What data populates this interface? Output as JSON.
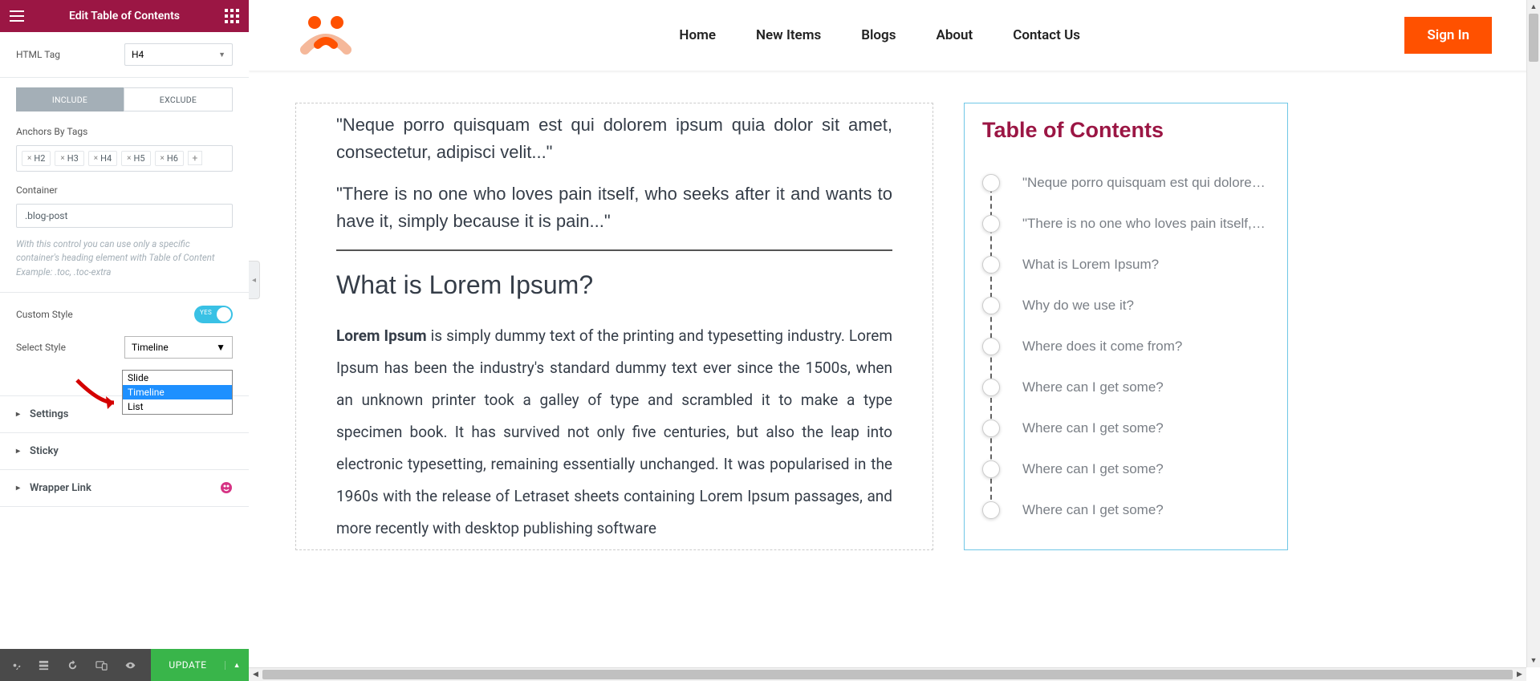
{
  "panel": {
    "title": "Edit Table of Contents",
    "htmlTagLabel": "HTML Tag",
    "htmlTagValue": "H4",
    "includeLabel": "INCLUDE",
    "excludeLabel": "EXCLUDE",
    "anchorsLabel": "Anchors By Tags",
    "tags": [
      "H2",
      "H3",
      "H4",
      "H5",
      "H6"
    ],
    "containerLabel": "Container",
    "containerValue": ".blog-post",
    "helpLine1": "With this control you can use only a specific container's heading element with Table of Content",
    "helpLine2": "Example: .toc, .toc-extra",
    "customStyleLabel": "Custom Style",
    "toggleText": "YES",
    "selectStyleLabel": "Select Style",
    "selectStyleValue": "Timeline",
    "options": {
      "opt0": "Slide",
      "opt1": "Timeline",
      "opt2": "List"
    },
    "acc": {
      "a0": "Settings",
      "a1": "Sticky",
      "a2": "Wrapper Link"
    },
    "updateLabel": "UPDATE"
  },
  "nav": {
    "n0": "Home",
    "n1": "New Items",
    "n2": "Blogs",
    "n3": "About",
    "n4": "Contact Us",
    "signin": "Sign In"
  },
  "post": {
    "q1": "\"Neque porro quisquam est qui dolorem ipsum quia dolor sit amet, consectetur, adipisci velit...\"",
    "q2": "\"There is no one who loves pain itself, who seeks after it and wants to have it, simply because it is pain...\"",
    "h2": "What is Lorem Ipsum?",
    "bodyBold": "Lorem Ipsum",
    "bodyRest": " is simply dummy text of the printing and typesetting industry. Lorem Ipsum has been the industry's standard dummy text ever since the 1500s, when an unknown printer took a galley of type and scrambled it to make a type specimen book. It has survived not only five centuries, but also the leap into electronic typesetting, remaining essentially unchanged. It was popularised in the 1960s with the release of Letraset sheets containing Lorem Ipsum passages, and more recently with desktop publishing software"
  },
  "toc": {
    "title": "Table of Contents",
    "items": {
      "i0": "\"Neque porro quisquam est qui dolorem i...",
      "i1": "\"There is no one who loves pain itself, wh...",
      "i2": "What is Lorem Ipsum?",
      "i3": "Why do we use it?",
      "i4": "Where does it come from?",
      "i5": "Where can I get some?",
      "i6": "Where can I get some?",
      "i7": "Where can I get some?",
      "i8": "Where can I get some?"
    }
  }
}
